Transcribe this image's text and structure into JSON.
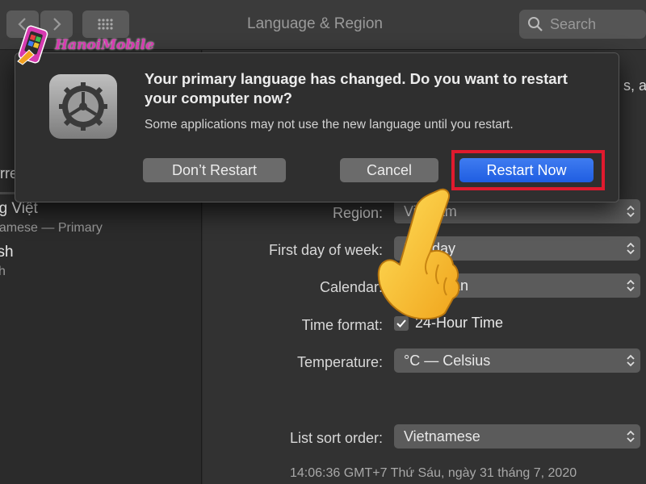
{
  "toolbar": {
    "title": "Language & Region",
    "search_placeholder": "Search"
  },
  "logo": {
    "text": "HanoiMobile"
  },
  "sidebar": {
    "preferred_label_partial": "erre",
    "languages": [
      {
        "name": "ng Việt",
        "sub": "namese — Primary"
      },
      {
        "name": "lish",
        "sub": "sh"
      }
    ]
  },
  "main": {
    "right_edge_text": "s, a",
    "region": {
      "label": "Region:",
      "value": "Vietnam"
    },
    "first_day": {
      "label": "First day of week:",
      "value": "Monday"
    },
    "calendar": {
      "label": "Calendar:",
      "value": "Gregorian"
    },
    "time_format": {
      "label": "Time format:",
      "value": "24-Hour Time",
      "checked": true
    },
    "temperature": {
      "label": "Temperature:",
      "value": "°C — Celsius"
    },
    "list_sort": {
      "label": "List sort order:",
      "value": "Vietnamese"
    },
    "clock": "14:06:36 GMT+7 Thứ Sáu, ngày 31 tháng 7, 2020"
  },
  "dialog": {
    "title": "Your primary language has changed. Do you want to restart your computer now?",
    "message": "Some applications may not use the new language until you restart.",
    "dont_restart": "Don’t Restart",
    "cancel": "Cancel",
    "restart_now": "Restart Now"
  },
  "colors": {
    "accent_blue": "#2a6ce8",
    "highlight_red": "#e01a2e",
    "logo_pink": "#d63ab0"
  }
}
